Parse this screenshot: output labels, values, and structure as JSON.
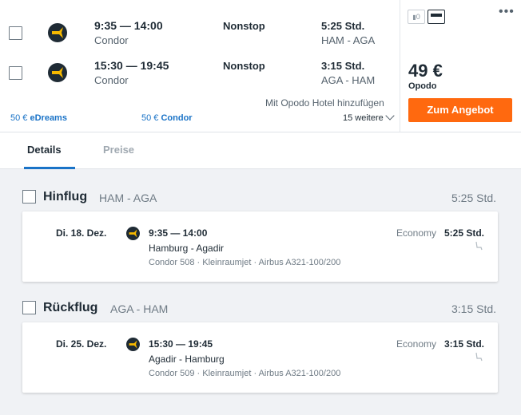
{
  "result": {
    "legs": [
      {
        "time": "9:35 — 14:00",
        "airline": "Condor",
        "stops": "Nonstop",
        "duration": "5:25 Std.",
        "route": "HAM - AGA"
      },
      {
        "time": "15:30 — 19:45",
        "airline": "Condor",
        "stops": "Nonstop",
        "duration": "3:15 Std.",
        "route": "AGA - HAM"
      }
    ],
    "providers": [
      {
        "price": "50 €",
        "name": "eDreams"
      },
      {
        "price": "50 €",
        "name": "Condor"
      }
    ],
    "hotel_add": "Mit Opodo Hotel hinzufügen",
    "more_deals": "15 weitere",
    "bag_count": "0",
    "price": "49 €",
    "price_source": "Opodo",
    "offer_button": "Zum Angebot",
    "menu_icon": "•••",
    "colors": {
      "accent": "#ff690f",
      "link": "#1a73c7",
      "condor_yellow": "#f7b900"
    }
  },
  "tabs": {
    "details": "Details",
    "prices": "Preise"
  },
  "outbound": {
    "title": "Hinflug",
    "route": "HAM - AGA",
    "total": "5:25 Std.",
    "segment": {
      "date": "Di. 18. Dez.",
      "time": "9:35 — 14:00",
      "cities": "Hamburg - Agadir",
      "info": "Condor 508 · Kleinraumjet · Airbus A321-100/200",
      "cabin": "Economy",
      "duration": "5:25 Std."
    }
  },
  "inbound": {
    "title": "Rückflug",
    "route": "AGA - HAM",
    "total": "3:15 Std.",
    "segment": {
      "date": "Di. 25. Dez.",
      "time": "15:30 — 19:45",
      "cities": "Agadir - Hamburg",
      "info": "Condor 509 · Kleinraumjet · Airbus A321-100/200",
      "cabin": "Economy",
      "duration": "3:15 Std."
    }
  }
}
